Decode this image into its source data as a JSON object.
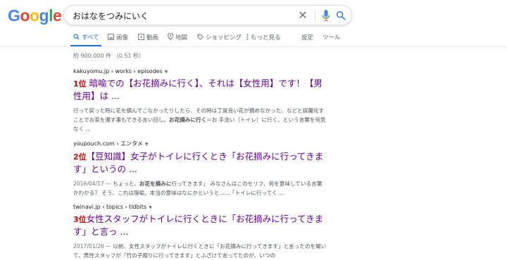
{
  "logo": {
    "letters": [
      "G",
      "o",
      "o",
      "g",
      "l",
      "e"
    ],
    "colors": [
      "#4285f4",
      "#ea4335",
      "#fbbc05",
      "#4285f4",
      "#34a853",
      "#ea4335"
    ]
  },
  "search": {
    "query": "おはなをつみにいく",
    "clear_glyph": "✕"
  },
  "tabs": {
    "all": "すべて",
    "images": "画像",
    "videos": "動画",
    "maps": "地図",
    "shopping": "ショッピング",
    "more": "もっと見る",
    "settings": "設定",
    "tools": "ツール"
  },
  "stats": "約 900,000 件 （0.51 秒）",
  "results": [
    {
      "cite": "kakuyomu.jp › works › episodes",
      "rank": "1位",
      "title": " 暗喩での【お花摘みに行く】、それは【女性用】です！【男性用】は ...",
      "snippet_pre": "行って戻った時に花を摘んでこなかったりしたら、その時は丁度良い花が摘めなかった、などと誤魔化すことでお茶を濁す事もできる言い回し。",
      "snippet_bold": "お花摘みに行く",
      "snippet_post": "＝お 手洗い（トイレ）に行く、という言葉を何気なく ..."
    },
    {
      "cite": "youpouch.com › エンタメ",
      "rank": "2位",
      "title": "【豆知識】女子がトイレに行くとき「お花摘みに行ってきます」というの ...",
      "date": "2016/04/17 — ",
      "snippet_pre": "ちょっと、",
      "snippet_bold": "お花を摘みに",
      "snippet_post": "行ってきます」 みなさんはこのセリフ、何を意味している言葉かわかる？ そう、これは隠喩。本当の意味はなにかというと......「トイレに行ってく ..."
    },
    {
      "cite": "twinavi.jp › topics › tidbits",
      "rank": "3位",
      "title": "女性スタッフがトイレに行くときに「お花摘みに行ってきます」と言っ ...",
      "date": "2017/01/26 — ",
      "snippet_pre": "以前、女性スタッフがトイレに行くときに「お花摘みに行ってきます」と言ったのを聞いて、男性スタッフが「竹の子掘りに行ってきます」とふざけて言ってたのが、いつの"
    }
  ]
}
